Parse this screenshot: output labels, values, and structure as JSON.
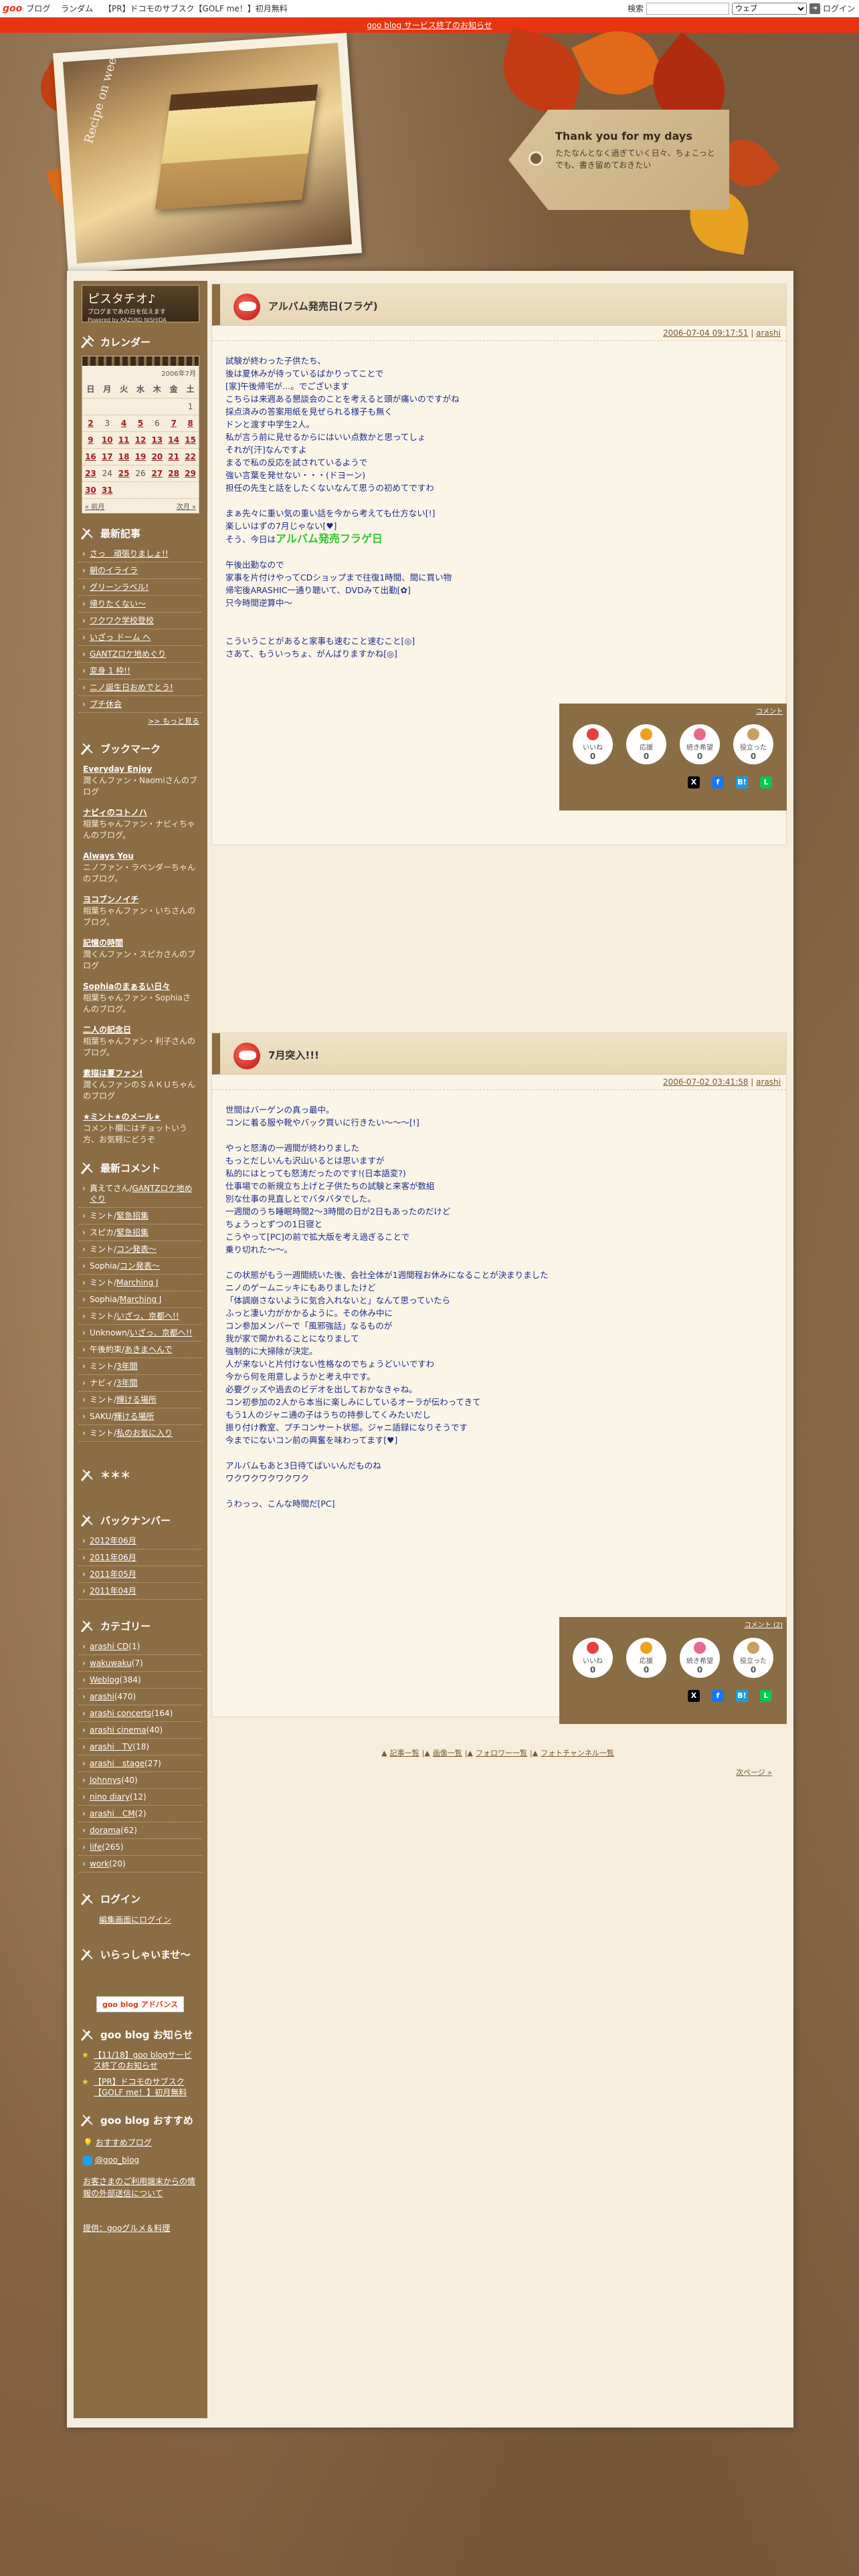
{
  "topbar": {
    "logo": "goo",
    "links": [
      "ブログ",
      "ランダム",
      "【PR】ドコモのサブスク【GOLF me！】初月無料"
    ],
    "search_label": "検索",
    "search_value": "",
    "search_type": "ウェブ",
    "login": "ログイン"
  },
  "notice": "goo blog サービス終了のお知らせ",
  "header": {
    "photo_caption": "Recipe on weekend",
    "tag_title": "Thank you for my days",
    "tag_sub": "たたなんとなく過ぎていく日々、ちょこっとでも、書き留めておきたい"
  },
  "blog": {
    "title": "ピスタチオ♪",
    "subtitle": "ブログまであの日を伝えます",
    "powered": "Powered by KAZUKO NISHIDA"
  },
  "sidebar": {
    "calendar": {
      "title": "カレンダー",
      "month": "2006年7月",
      "weekdays": [
        "日",
        "月",
        "火",
        "水",
        "木",
        "金",
        "土"
      ],
      "rows": [
        [
          "",
          "",
          "",
          "",
          "",
          "",
          "1"
        ],
        [
          "2",
          "3",
          "4",
          "5",
          "6",
          "7",
          "8"
        ],
        [
          "9",
          "10",
          "11",
          "12",
          "13",
          "14",
          "15"
        ],
        [
          "16",
          "17",
          "18",
          "19",
          "20",
          "21",
          "22"
        ],
        [
          "23",
          "24",
          "25",
          "26",
          "27",
          "28",
          "29"
        ],
        [
          "30",
          "31",
          "",
          "",
          "",
          "",
          ""
        ]
      ],
      "linked": [
        "2",
        "4",
        "5",
        "7",
        "8",
        "9",
        "10",
        "11",
        "12",
        "13",
        "14",
        "15",
        "16",
        "17",
        "18",
        "19",
        "20",
        "21",
        "22",
        "23",
        "25",
        "27",
        "28",
        "29",
        "30",
        "31"
      ],
      "prev": "« 前月",
      "next": "次月 »"
    },
    "recent_title": "最新記事",
    "recent": [
      "さっ　頑張りましょ!!",
      "朝のイライラ",
      "グリーンラベル!",
      "帰りたくない～",
      "ワクワク学校登校",
      "いざっ ドーム へ",
      "GANTZロケ地めぐり",
      "変身 1 枠!!",
      "ニノ誕生日おめでとう!",
      "プチ休会"
    ],
    "more": ">> もっと見る",
    "bookmark_title": "ブックマーク",
    "bookmarks": [
      {
        "name": "Everyday Enjoy",
        "desc": "潤くんファン・Naomiさんのブログ"
      },
      {
        "name": "ナビィのコトノハ",
        "desc": "相葉ちゃんファン・ナビィちゃんのブログ。"
      },
      {
        "name": "Always You",
        "desc": "ニノファン・ラベンダーちゃんのブログ。"
      },
      {
        "name": "ヨコブンノイチ",
        "desc": "相葉ちゃんファン・いちさんのブログ。"
      },
      {
        "name": "記憶の時間",
        "desc": "潤くんファン・スピカさんのブログ"
      },
      {
        "name": "Sophiaのまぁるい日々",
        "desc": "相葉ちゃんファン・Sophiaさんのブログ。"
      },
      {
        "name": "二人の記念日",
        "desc": "相葉ちゃんファン・利子さんのブログ。"
      },
      {
        "name": "素描は夏ファン!",
        "desc": "潤くんファンのＳＡＫＵちゃんのブログ"
      },
      {
        "name": "★ミント★のメール★",
        "desc": "コメント欄にはチョットいう方、お気軽にどうぞ"
      }
    ],
    "comments_title": "最新コメント",
    "comments": [
      {
        "who": "真えてさん",
        "on": "GANTZロケ地めぐり"
      },
      {
        "who": "ミント",
        "on": "緊急招集"
      },
      {
        "who": "スピカ",
        "on": "緊急招集"
      },
      {
        "who": "ミント",
        "on": "コン発表～"
      },
      {
        "who": "Sophia",
        "on": "コン発表～"
      },
      {
        "who": "ミント",
        "on": "Marching J"
      },
      {
        "who": "Sophia",
        "on": "Marching J"
      },
      {
        "who": "ミント",
        "on": "いざっ、京都へ!!"
      },
      {
        "who": "Unknown",
        "on": "いざっ、京都へ!!"
      },
      {
        "who": "午後約束",
        "on": "あきまへんで"
      },
      {
        "who": "ミント",
        "on": "3年間"
      },
      {
        "who": "ナビィ",
        "on": "3年間"
      },
      {
        "who": "ミント",
        "on": "輝ける場所"
      },
      {
        "who": "SAKU",
        "on": "輝ける場所"
      },
      {
        "who": "ミント",
        "on": "私のお気に入り"
      }
    ],
    "star_title": "＊＊＊",
    "backnumber_title": "バックナンバー",
    "backnumbers": [
      "2012年06月",
      "2011年06月",
      "2011年05月",
      "2011年04月"
    ],
    "category_title": "カテゴリー",
    "categories": [
      "arashi CD(1)",
      "wakuwaku(7)",
      "Weblog(384)",
      "arashi(470)",
      "arashi concerts(164)",
      "arashi cinema(40)",
      "arashi　TV(18)",
      "arashi　stage(27)",
      "Johnnys(40)",
      "nino diary(12)",
      "arashi　CM(2)",
      "dorama(62)",
      "life(265)",
      "work(20)"
    ],
    "login_title": "ログイン",
    "login_link": "編集画面にログイン",
    "welcome_title": "いらっしゃいませ〜",
    "adv_button": "goo blog アドバンス",
    "goo_news_title": "goo blog お知らせ",
    "goo_news": [
      "【11/18】goo blogサービス終了のお知らせ",
      "【PR】ドコモのサブスク【GOLF me！】初月無料"
    ],
    "goo_rec_title": "goo blog おすすめ",
    "goo_rec": [
      "おすすめブログ",
      "@goo_blog"
    ],
    "goo_help": "お客さまのご利用端末からの情報の外部送信について",
    "footer": "提供：gooグルメ＆料理"
  },
  "posts": [
    {
      "title": "アルバム発売日(フラゲ)",
      "date": "2006-07-04 09:17:51",
      "author": "arashi",
      "body": "試験が終わった子供たち、\n後は夏休みが待っているばかりってことで\n[家]午後帰宅が…。でございます\nこちらは来週ある懇談会のことを考えると頭が痛いのですがね\n採点済みの答案用紙を見ぜられる様子も無く\nドンと渡す中学生2人。\n私が言う前に見せるからにはいい点数かと思ってしょ\nそれが[汗]なんですよ\nまるで私の反応を試されているようで\n強い言葉を発せない・・・(ドヨーン)\n担任の先生と話をしたくないなんて思うの初めてですわ\n\nまぁ先々に重い気の重い話を今から考えても仕方ない[!]\n楽しいはずの7月じゃない[♥]\nそう、今日は",
      "highlight": "アルバム発売フラゲ日",
      "body2": "\n\n午後出勤なので\n家事を片付けやってCDショップまで往復1時間、間に買い物\n帰宅後ARASHIC一通り聴いて、DVDみて出勤[✿]\n只今時間逆算中〜\n\n\nこういうことがあると家事も速むこと速むこと[◎]\nさあて、もういっちょ、がんばりますかね[◎]",
      "comment_label": "コメント",
      "reactions": [
        {
          "label": "いいね",
          "n": "0"
        },
        {
          "label": "応援",
          "n": "0"
        },
        {
          "label": "続き希望",
          "n": "0"
        },
        {
          "label": "役立った",
          "n": "0"
        }
      ]
    },
    {
      "title": "7月突入!!!",
      "date": "2006-07-02 03:41:58",
      "author": "arashi",
      "body": "世間はバーゲンの真っ最中。\nコンに着る服や靴やバック買いに行きたい〜〜〜[!]\n\nやっと怒涛の一週間が終わりました\nもっとだしいんも沢山いるとは思いますが\n私的にはとっても怒涛だったのです!(日本語変?)\n仕事場での新規立ち上げと子供たちの試験と来客が数組\n別な仕事の見直しとでバタバタでした。\n一週間のうち睡眠時間2〜3時間の日が2日もあったのだけど\nちょうっとずつの1日寝と\nこうやって[PC]の前で拡大版を考え過ぎることで\n乗り切れた〜〜。\n\nこの状態がもう一週間続いた後、会社全体が1週間程お休みになることが決まりました\nニノのゲームニッキにもありましたけど\n「体調崩さないように気合入れないと」なんて思っていたら\nふっと凄い力がかかるように。その休み中に\nコン参加メンバーで「風邪強話」なるものが\n我が家で開かれることになりまして\n強制的に大掃除が決定。\n人が来ないと片付けない性格なのでちょうどいいですわ\n今から何を用意しようかと考え中です。\n必要グッズや過去のビデオを出しておかなきゃね。\nコン初参加の2人から本当に楽しみにしているオーラが伝わってきて\nもう1人のジャニ通の子はうちの持参してくみたいだし\n振り付け教室、プチコンサート状態。ジャニ語録になりそうです\n今までにないコン前の興奮を味わってます[♥]\n\nアルバムもあと3日待てばいいんだものね\nワクワクワクワクワク\n\nうわっっ、こんな時間だ[PC]",
      "comment_label": "コメント (2)",
      "reactions": [
        {
          "label": "いいね",
          "n": "0"
        },
        {
          "label": "応援",
          "n": "0"
        },
        {
          "label": "続き希望",
          "n": "0"
        },
        {
          "label": "役立った",
          "n": "0"
        }
      ]
    }
  ],
  "pager": {
    "items": [
      "記事一覧",
      "画像一覧",
      "フォロワー一覧",
      "フォトチャンネル一覧"
    ],
    "next": "次ページ »"
  },
  "colors": {
    "accent": "#e8340f",
    "sidebar": "#8a6d45",
    "text_blue": "#1a2a8a"
  }
}
